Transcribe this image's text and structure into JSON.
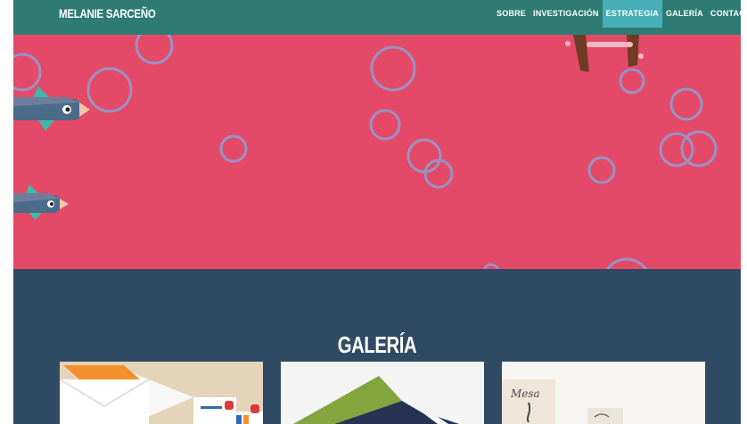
{
  "brand": {
    "name": "MELANIE SARCEÑO"
  },
  "nav": {
    "items": [
      {
        "label": "SOBRE MÍ"
      },
      {
        "label": "INVESTIGACIÓN"
      },
      {
        "label": "ESTRATEGIA",
        "active": true
      },
      {
        "label": "GALERÍA"
      },
      {
        "label": "CONTACTO"
      }
    ]
  },
  "hero": {
    "background_color": "#e44a67"
  },
  "gallery": {
    "title": "GALERÍA",
    "thumbnails": [
      {
        "name": "stationery-envelopes"
      },
      {
        "name": "green-navy-cards"
      },
      {
        "name": "mesa-invitation"
      }
    ]
  },
  "colors": {
    "navbar": "#2d7b73",
    "nav_active": "#45aeb9",
    "hero": "#e44a67",
    "gallery": "#2f4b63"
  }
}
